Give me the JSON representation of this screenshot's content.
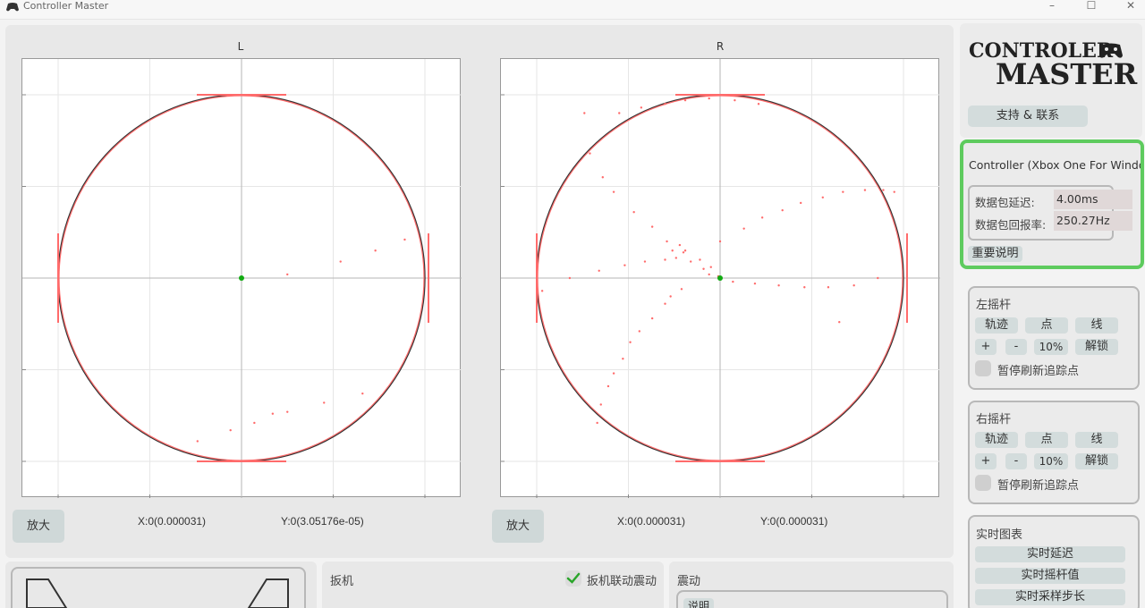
{
  "window": {
    "title": "Controller Master",
    "minimize": "–",
    "maximize": "☐",
    "close": "✕"
  },
  "plots": {
    "left": {
      "title": "L",
      "zoom_label": "放大",
      "x_readout": "X:0(0.000031)",
      "y_readout": "Y:0(3.05176e-05)"
    },
    "right": {
      "title": "R",
      "zoom_label": "放大",
      "x_readout": "X:0(0.000031)",
      "y_readout": "Y:0(0.000031)"
    }
  },
  "sidebar": {
    "logo_line1": "CONTROLER",
    "logo_line2": "MASTER",
    "support_label": "支持 & 联系",
    "controller_name": "Controller (Xbox One For Windows)",
    "latency_label": "数据包延迟:",
    "latency_value": "4.00ms",
    "rate_label": "数据包回报率:",
    "rate_value": "250.27Hz",
    "notes_label": "重要说明",
    "left_stick": {
      "title": "左摇杆",
      "trace": "轨迹",
      "dot": "点",
      "line": "线",
      "plus": "+",
      "minus": "-",
      "percent": "10%",
      "unlock": "解锁",
      "pause": "暂停刷新追踪点"
    },
    "right_stick": {
      "title": "右摇杆",
      "trace": "轨迹",
      "dot": "点",
      "line": "线",
      "plus": "+",
      "minus": "-",
      "percent": "10%",
      "unlock": "解锁",
      "pause": "暂停刷新追踪点"
    },
    "realtime": {
      "title": "实时图表",
      "latency": "实时延迟",
      "stick_values": "实时摇杆值",
      "sample_step": "实时采样步长"
    }
  },
  "bottom": {
    "trigger_title": "扳机",
    "trigger_vibration_label": "扳机联动震动",
    "vibration_title": "震动",
    "explain_label": "说明"
  },
  "colors": {
    "accent_green": "#5ecb5e",
    "trace_red": "#ff6b6b",
    "center_green": "#11aa11"
  },
  "chart_data": [
    {
      "type": "scatter",
      "title": "L",
      "xlim": [
        -1,
        1
      ],
      "ylim": [
        -1,
        1
      ],
      "grid": true,
      "center": [
        0,
        0
      ],
      "points": [
        [
          0.25,
          0.02
        ],
        [
          0.54,
          0.09
        ],
        [
          0.73,
          0.15
        ],
        [
          0.89,
          0.21
        ],
        [
          0.17,
          -0.74
        ],
        [
          0.07,
          -0.79
        ],
        [
          -0.06,
          -0.83
        ],
        [
          -0.24,
          -0.89
        ],
        [
          0.25,
          -0.73
        ],
        [
          0.45,
          -0.68
        ],
        [
          0.66,
          -0.63
        ]
      ]
    },
    {
      "type": "scatter",
      "title": "R",
      "xlim": [
        -1,
        1
      ],
      "ylim": [
        -1,
        1
      ],
      "grid": true,
      "center": [
        0,
        0
      ],
      "points": [
        [
          -0.71,
          0.68
        ],
        [
          -0.64,
          0.55
        ],
        [
          -0.58,
          0.47
        ],
        [
          -0.47,
          0.36
        ],
        [
          -0.37,
          0.28
        ],
        [
          -0.29,
          0.2
        ],
        [
          -0.2,
          0.14
        ],
        [
          -0.11,
          0.1
        ],
        [
          -0.05,
          0.06
        ],
        [
          -0.74,
          0.9
        ],
        [
          -0.55,
          0.9
        ],
        [
          -0.43,
          0.93
        ],
        [
          -0.3,
          0.95
        ],
        [
          -0.19,
          0.97
        ],
        [
          -0.06,
          0.98
        ],
        [
          0.08,
          0.97
        ],
        [
          0.21,
          0.95
        ],
        [
          -0.22,
          0.18
        ],
        [
          -0.26,
          0.15
        ],
        [
          -0.19,
          0.15
        ],
        [
          0.0,
          0.2
        ],
        [
          0.13,
          0.27
        ],
        [
          0.23,
          0.33
        ],
        [
          0.34,
          0.37
        ],
        [
          0.44,
          0.41
        ],
        [
          0.56,
          0.44
        ],
        [
          0.67,
          0.47
        ],
        [
          0.79,
          0.48
        ],
        [
          0.89,
          0.48
        ],
        [
          0.95,
          0.47
        ],
        [
          -0.97,
          -0.07
        ],
        [
          -0.82,
          0.0
        ],
        [
          -0.66,
          0.04
        ],
        [
          -0.52,
          0.07
        ],
        [
          -0.41,
          0.09
        ],
        [
          -0.3,
          0.1
        ],
        [
          -0.24,
          0.11
        ],
        [
          -0.16,
          0.09
        ],
        [
          -0.09,
          0.05
        ],
        [
          -0.06,
          0.02
        ],
        [
          -0.01,
          0.01
        ],
        [
          0.07,
          -0.02
        ],
        [
          0.19,
          -0.03
        ],
        [
          0.32,
          -0.04
        ],
        [
          0.46,
          -0.05
        ],
        [
          0.59,
          -0.05
        ],
        [
          0.73,
          -0.04
        ],
        [
          0.86,
          -0.0
        ],
        [
          0.65,
          -0.24
        ],
        [
          -0.21,
          -0.06
        ],
        [
          -0.27,
          -0.1
        ],
        [
          -0.3,
          -0.14
        ],
        [
          -0.37,
          -0.22
        ],
        [
          -0.44,
          -0.29
        ],
        [
          -0.49,
          -0.35
        ],
        [
          -0.53,
          -0.44
        ],
        [
          -0.58,
          -0.52
        ],
        [
          -0.61,
          -0.59
        ],
        [
          -0.65,
          -0.69
        ],
        [
          -0.67,
          -0.79
        ]
      ]
    }
  ]
}
